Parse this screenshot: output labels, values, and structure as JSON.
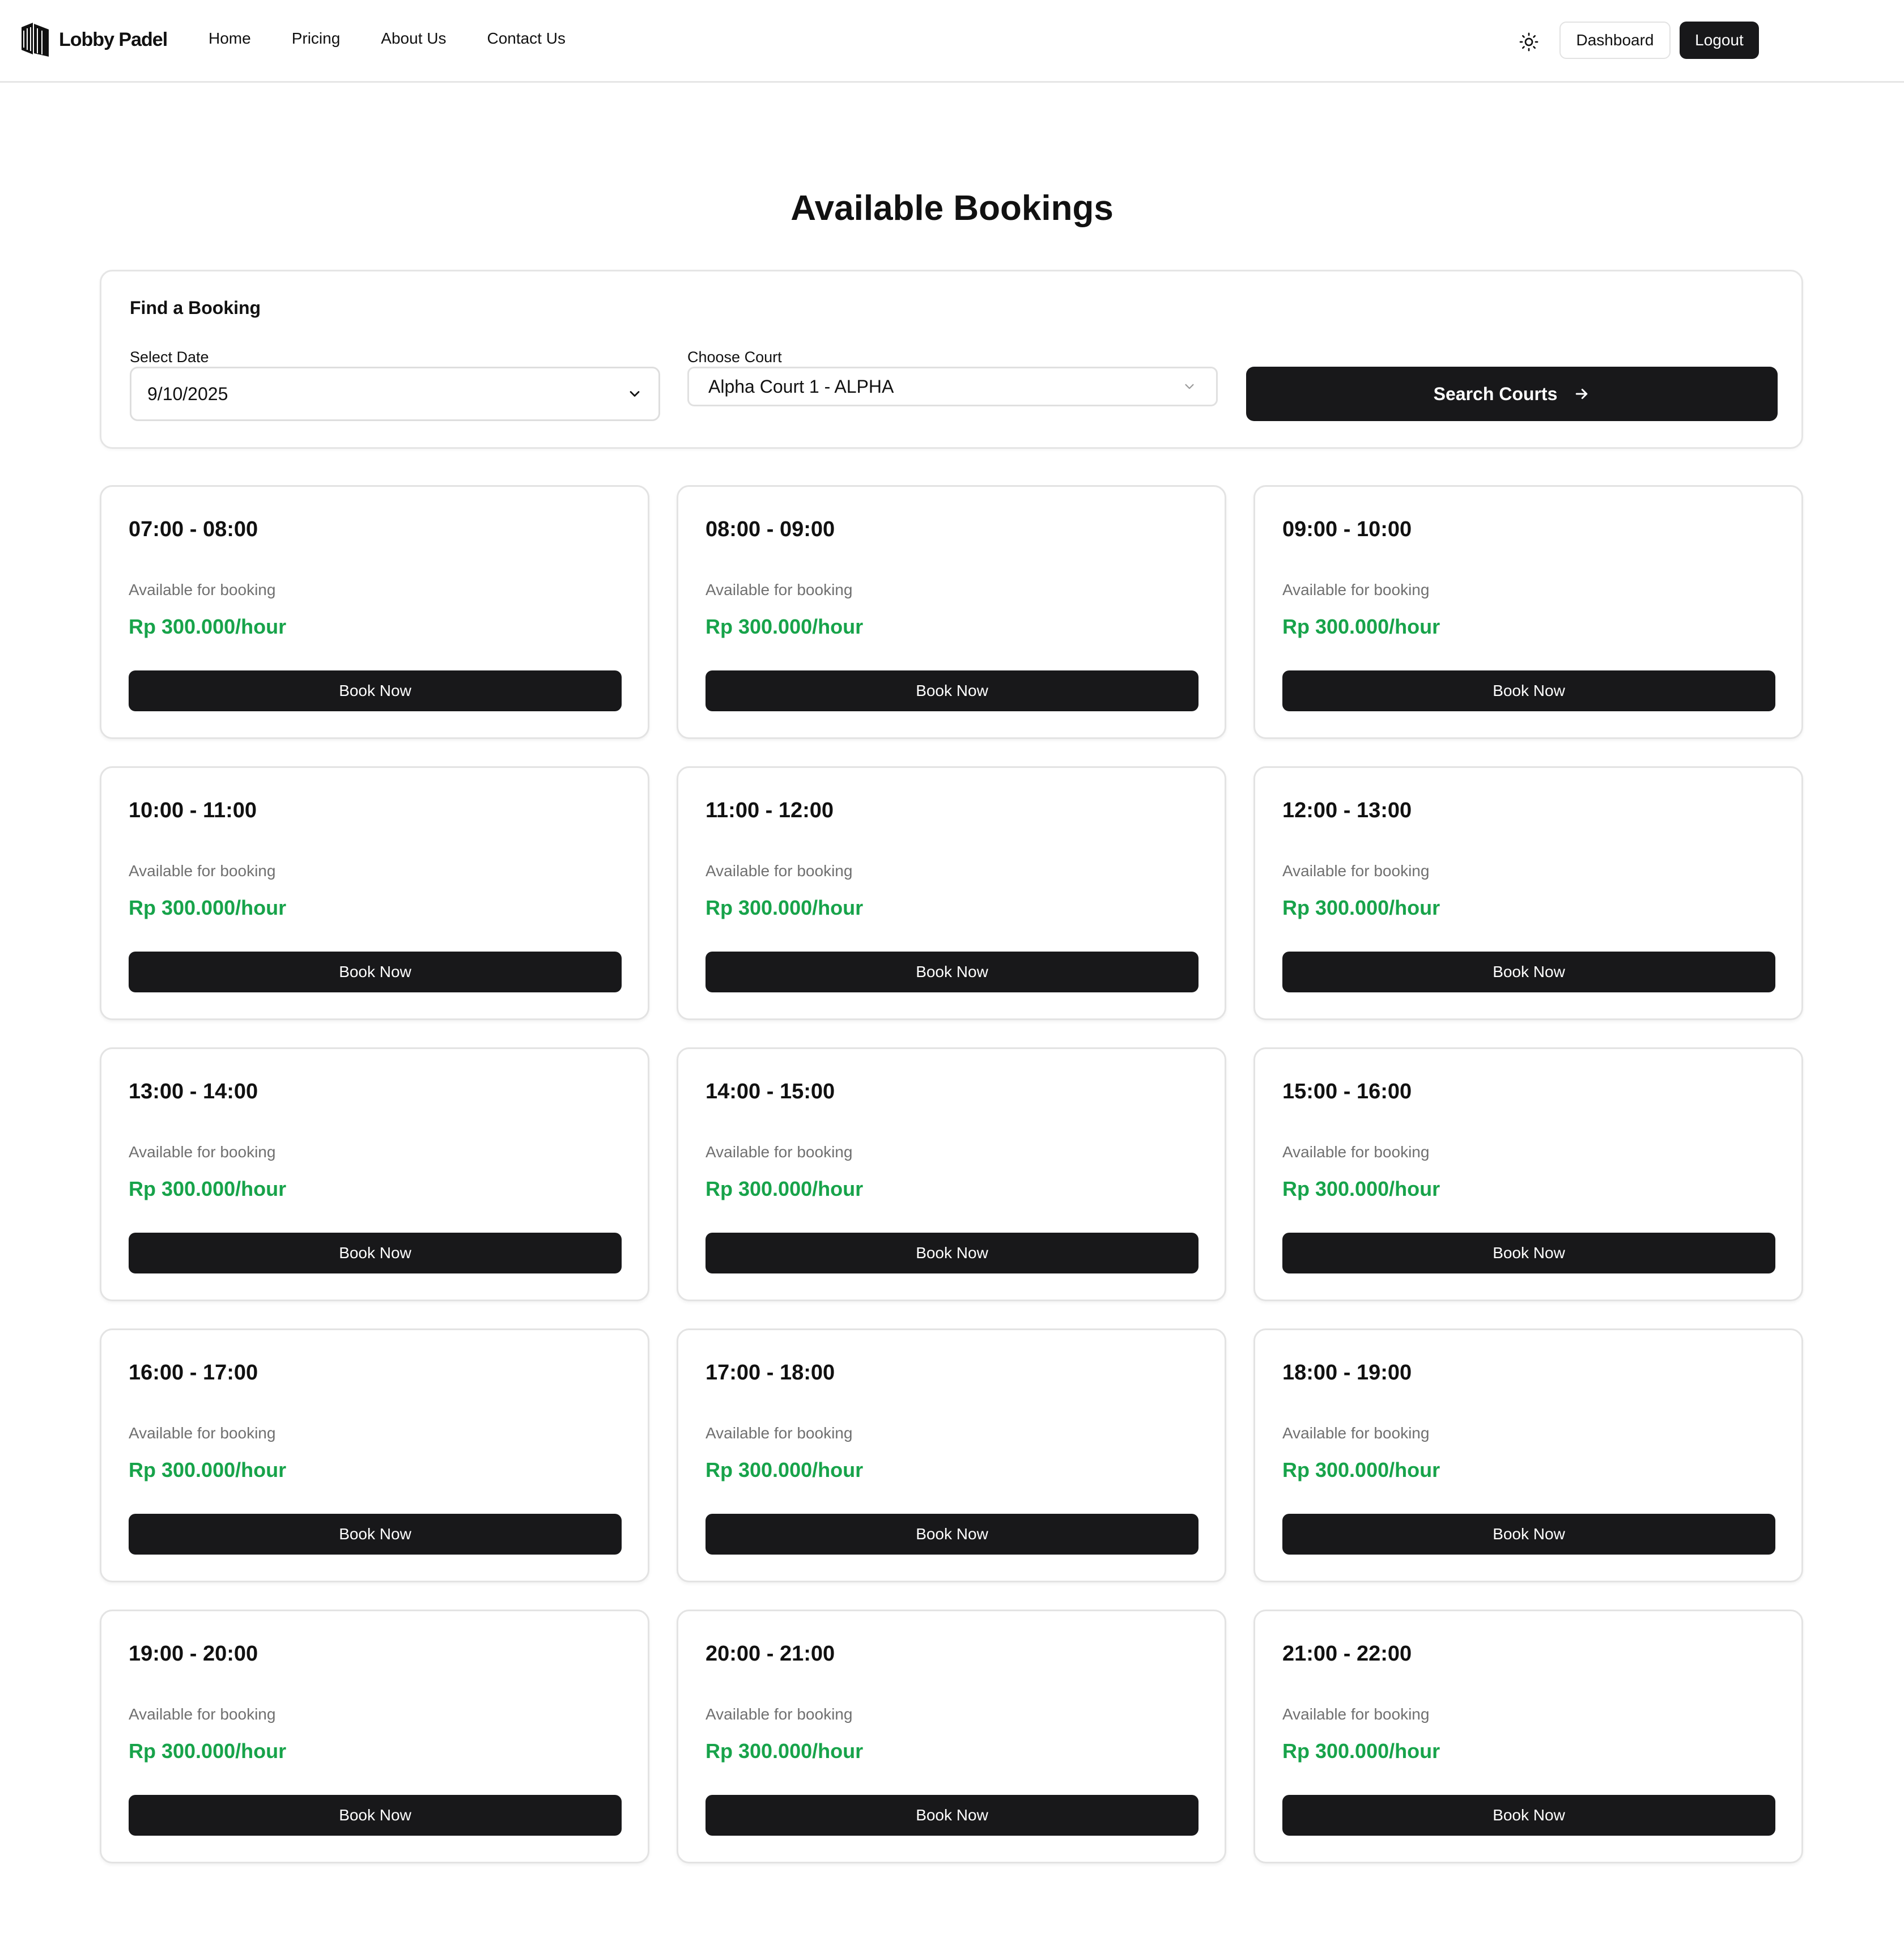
{
  "header": {
    "brand": "Lobby Padel",
    "nav": [
      "Home",
      "Pricing",
      "About Us",
      "Contact Us"
    ],
    "dashboard_label": "Dashboard",
    "logout_label": "Logout"
  },
  "page_title": "Available Bookings",
  "finder": {
    "title": "Find a Booking",
    "date_label": "Select Date",
    "date_value": "9/10/2025",
    "court_label": "Choose Court",
    "court_value": "Alpha Court 1 - ALPHA",
    "search_label": "Search Courts"
  },
  "slots": [
    {
      "time": "07:00 - 08:00",
      "status": "Available for booking",
      "price": "Rp 300.000/hour",
      "button": "Book Now"
    },
    {
      "time": "08:00 - 09:00",
      "status": "Available for booking",
      "price": "Rp 300.000/hour",
      "button": "Book Now"
    },
    {
      "time": "09:00 - 10:00",
      "status": "Available for booking",
      "price": "Rp 300.000/hour",
      "button": "Book Now"
    },
    {
      "time": "10:00 - 11:00",
      "status": "Available for booking",
      "price": "Rp 300.000/hour",
      "button": "Book Now"
    },
    {
      "time": "11:00 - 12:00",
      "status": "Available for booking",
      "price": "Rp 300.000/hour",
      "button": "Book Now"
    },
    {
      "time": "12:00 - 13:00",
      "status": "Available for booking",
      "price": "Rp 300.000/hour",
      "button": "Book Now"
    },
    {
      "time": "13:00 - 14:00",
      "status": "Available for booking",
      "price": "Rp 300.000/hour",
      "button": "Book Now"
    },
    {
      "time": "14:00 - 15:00",
      "status": "Available for booking",
      "price": "Rp 300.000/hour",
      "button": "Book Now"
    },
    {
      "time": "15:00 - 16:00",
      "status": "Available for booking",
      "price": "Rp 300.000/hour",
      "button": "Book Now"
    },
    {
      "time": "16:00 - 17:00",
      "status": "Available for booking",
      "price": "Rp 300.000/hour",
      "button": "Book Now"
    },
    {
      "time": "17:00 - 18:00",
      "status": "Available for booking",
      "price": "Rp 300.000/hour",
      "button": "Book Now"
    },
    {
      "time": "18:00 - 19:00",
      "status": "Available for booking",
      "price": "Rp 300.000/hour",
      "button": "Book Now"
    },
    {
      "time": "19:00 - 20:00",
      "status": "Available for booking",
      "price": "Rp 300.000/hour",
      "button": "Book Now"
    },
    {
      "time": "20:00 - 21:00",
      "status": "Available for booking",
      "price": "Rp 300.000/hour",
      "button": "Book Now"
    },
    {
      "time": "21:00 - 22:00",
      "status": "Available for booking",
      "price": "Rp 300.000/hour",
      "button": "Book Now"
    }
  ],
  "colors": {
    "accent_dark": "#18181a",
    "price_green": "#17a34a",
    "muted_text": "#707070",
    "border": "#e3e3e3"
  },
  "icons": {
    "logo": "lobby-padel-logo-icon",
    "theme": "sun-icon",
    "date_dropdown": "chevron-down-icon",
    "court_dropdown": "chevron-down-icon",
    "search": "arrow-right-icon"
  }
}
